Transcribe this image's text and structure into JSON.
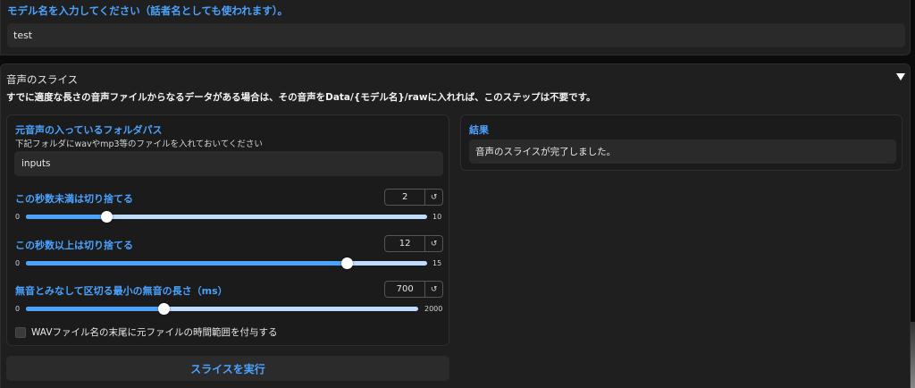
{
  "model": {
    "label": "モデル名を入力してください（話者名としても使われます）。",
    "value": "test"
  },
  "slice": {
    "title": "音声のスライス",
    "note": "すでに適度な長さの音声ファイルからなるデータがある場合は、その音声をData/{モデル名}/rawに入れれば、このステップは不要です。",
    "folder_label": "元音声の入っているフォルダパス",
    "folder_info": "下記フォルダにwavやmp3等のファイルを入れておいてください",
    "folder_value": "inputs",
    "sliders": [
      {
        "label": "この秒数未満は切り捨てる",
        "value": 2,
        "display": "2",
        "min": 0,
        "max": 10,
        "min_label": "0",
        "max_label": "10"
      },
      {
        "label": "この秒数以上は切り捨てる",
        "value": 12,
        "display": "12",
        "min": 0,
        "max": 15,
        "min_label": "0",
        "max_label": "15"
      },
      {
        "label": "無音とみなして区切る最小の無音の長さ（ms）",
        "value": 700,
        "display": "700",
        "min": 0,
        "max": 2000,
        "min_label": "0",
        "max_label": "2000"
      }
    ],
    "reset_glyph": "↺",
    "checkbox_label": "WAVファイル名の末尾に元ファイルの時間範囲を付与する",
    "checkbox_checked": false,
    "run_label": "スライスを実行",
    "result_label": "結果",
    "result_value": "音声のスライスが完了しました。"
  },
  "colors": {
    "accent": "#4aa3ff",
    "track_light": "#bfdbfe",
    "panel": "#1f1f1f"
  },
  "icons": {
    "collapse": "triangle-down-icon",
    "reset": "reset-icon"
  }
}
